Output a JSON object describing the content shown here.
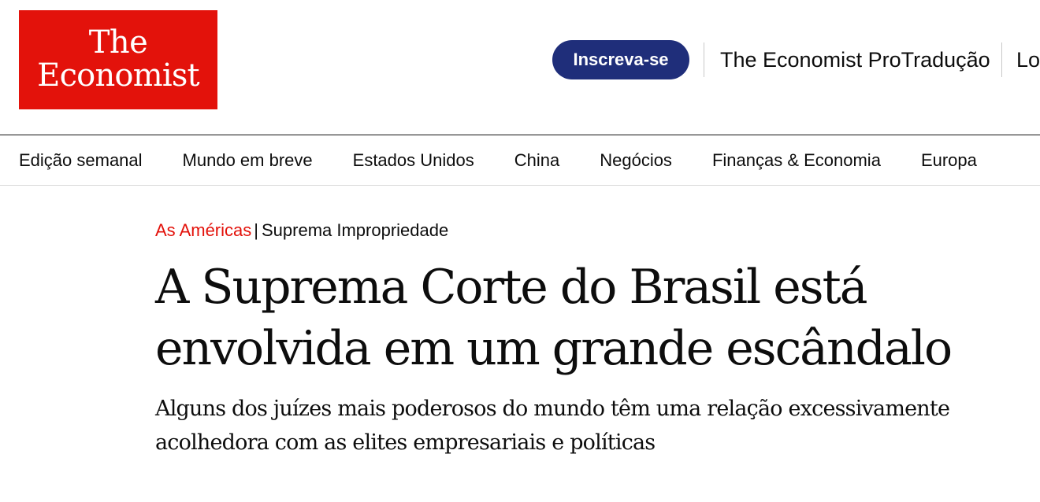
{
  "brand": {
    "logo_line1": "The",
    "logo_line2": "Economist",
    "color_red": "#e3120b",
    "color_navy": "#1f2e7a"
  },
  "header": {
    "subscribe_label": "Inscreva-se",
    "protraducao_label": "The Economist ProTradução",
    "login_label": "Lo"
  },
  "nav": {
    "items": [
      {
        "label": "Edição semanal"
      },
      {
        "label": "Mundo em breve"
      },
      {
        "label": "Estados Unidos"
      },
      {
        "label": "China"
      },
      {
        "label": "Negócios"
      },
      {
        "label": "Finanças & Economia"
      },
      {
        "label": "Europa"
      }
    ]
  },
  "article": {
    "section": "As Américas",
    "separator": "|",
    "flytitle": "Suprema Impropriedade",
    "headline": "A Suprema Corte do Brasil está envolvida em um grande escândalo",
    "description": "Alguns dos juízes mais poderosos do mundo têm uma relação excessivamente acolhedora com as elites empresariais e políticas"
  }
}
